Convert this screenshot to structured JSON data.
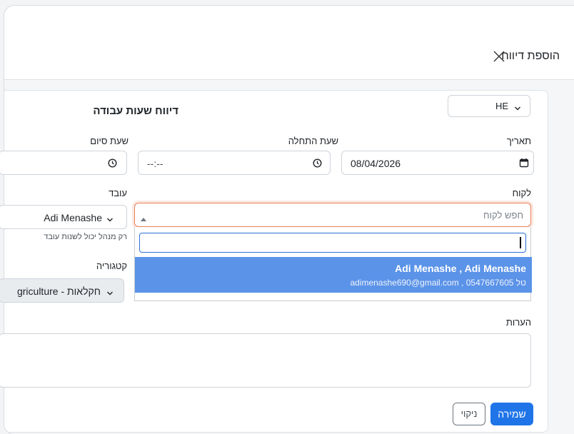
{
  "modal": {
    "title": "הוספת דיווח"
  },
  "form": {
    "title": "דיווח שעות עבודה",
    "language": {
      "value": "HE"
    },
    "date": {
      "label": "תאריך",
      "value": "08/04/2026"
    },
    "start_time": {
      "label": "שעת התחלה",
      "value": "--:--"
    },
    "end_time": {
      "label": "שעת סיום"
    },
    "customer": {
      "label": "לקוח",
      "placeholder": "חפש לקוח",
      "dropdown": {
        "search_value": "",
        "options": [
          {
            "title": "Adi Menashe , Adi Menashe",
            "subtitle": "טל 0547667605 , adimenashe690@gmail.com"
          }
        ]
      }
    },
    "employee": {
      "label": "עובד",
      "value": "Adi Menashe",
      "hint": "רק מנהל יכול לשנות עובד"
    },
    "category": {
      "label": "קטגוריה",
      "value": "griculture - חקלאות"
    },
    "notes": {
      "label": "הערות",
      "value": ""
    },
    "buttons": {
      "save": "שמירה",
      "clear": "ניקוי"
    }
  },
  "colors": {
    "primary": "#1f74e8",
    "focus_border": "#e8825a",
    "option_highlight": "#5b93e8"
  }
}
